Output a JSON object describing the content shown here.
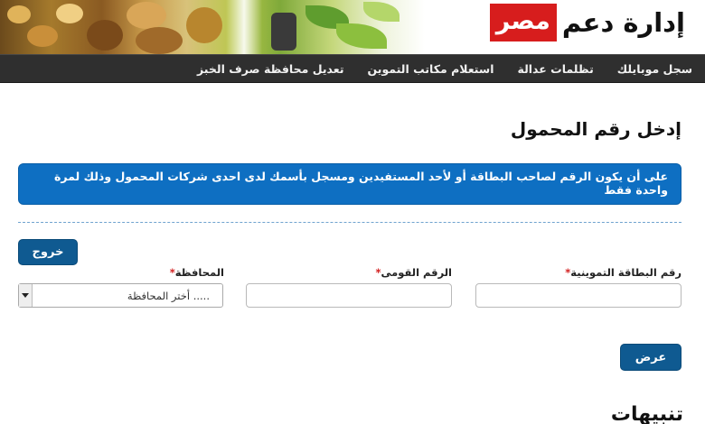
{
  "header": {
    "logo_text": "إدارة دعم",
    "logo_highlight": "مصر"
  },
  "nav": {
    "items": [
      {
        "label": "سجل موبايلك"
      },
      {
        "label": "تظلمات عدالة"
      },
      {
        "label": "استعلام مكاتب التموين"
      },
      {
        "label": "تعديل محافظة صرف الخبز"
      }
    ]
  },
  "page": {
    "title": "إدخل رقم المحمول",
    "alert": "على أن يكون الرقم لصاحب البطاقة أو لأحد المستفيدين ومسجل بأسمك لدى احدى شركات المحمول وذلك لمرة واحدة فقط"
  },
  "form": {
    "logout_label": "خروج",
    "card_label": "رقم البطاقة التموينية",
    "nid_label": "الرقم القومى",
    "gov_label": "المحافظة",
    "required_mark": "*",
    "card_value": "",
    "nid_value": "",
    "gov_selected": "..... أختر المحافظة",
    "submit_label": "عرض"
  },
  "notices": {
    "title": "تنبيهات"
  },
  "colors": {
    "nav_bg": "#2f2f2f",
    "alert_bg": "#0e6fc2",
    "button_bg": "#0f5a91",
    "logo_red": "#d71d1d",
    "required": "#d32020"
  }
}
